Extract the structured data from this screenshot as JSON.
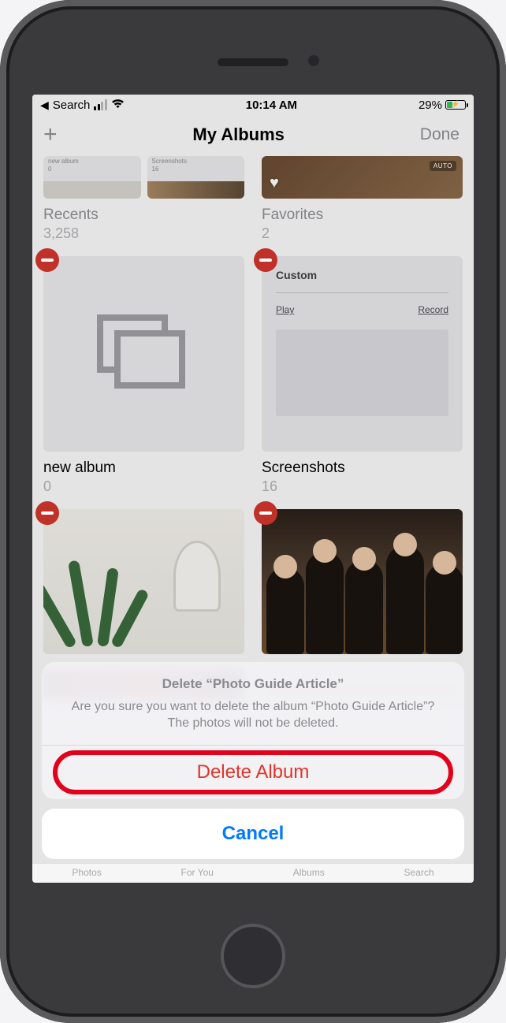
{
  "status": {
    "back_app": "Search",
    "time": "10:14 AM",
    "battery_pct": "29%"
  },
  "nav": {
    "title": "My Albums",
    "done": "Done"
  },
  "mini_albums": {
    "left": {
      "label": "new album",
      "count": "0"
    },
    "mid": {
      "label": "Screenshots",
      "count": "16"
    },
    "right_badge": "AUTO"
  },
  "albums": {
    "recents": {
      "name": "Recents",
      "count": "3,258"
    },
    "favorites": {
      "name": "Favorites",
      "count": "2"
    },
    "new_album": {
      "name": "new album",
      "count": "0"
    },
    "screenshots": {
      "name": "Screenshots",
      "count": "16",
      "preview": {
        "title": "Custom",
        "left": "Play",
        "right": "Record"
      }
    }
  },
  "tabs": {
    "photos": "Photos",
    "foryou": "For You",
    "albums": "Albums",
    "search": "Search"
  },
  "sheet": {
    "title": "Delete “Photo Guide Article”",
    "message": "Are you sure you want to delete the album “Photo Guide Article”? The photos will not be deleted.",
    "destructive": "Delete Album",
    "cancel": "Cancel"
  }
}
